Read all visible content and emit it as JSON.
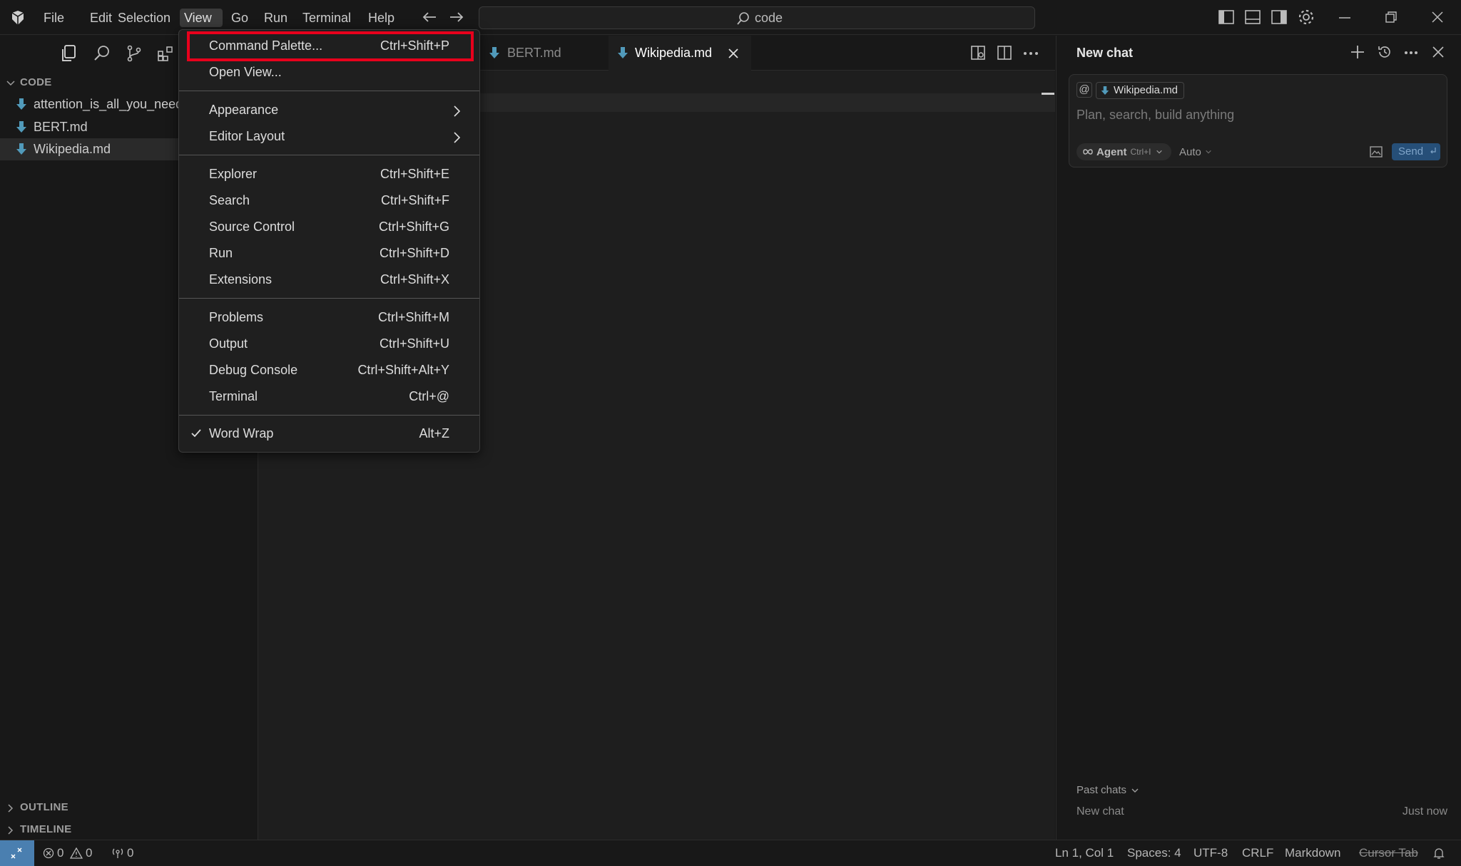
{
  "titlebar": {
    "menus": [
      "File",
      "Edit",
      "Selection",
      "View",
      "Go",
      "Run",
      "Terminal",
      "Help"
    ],
    "active_menu": "View",
    "command_center": "code"
  },
  "sidebar": {
    "section_title": "CODE",
    "files": [
      "attention_is_all_you_need.md",
      "BERT.md",
      "Wikipedia.md"
    ],
    "selected_file": "Wikipedia.md",
    "outline_label": "OUTLINE",
    "timeline_label": "TIMELINE"
  },
  "tabs": [
    {
      "label": "BERT.md",
      "active": false
    },
    {
      "label": "Wikipedia.md",
      "active": true
    }
  ],
  "view_menu": {
    "groups": [
      [
        {
          "label": "Command Palette...",
          "shortcut": "Ctrl+Shift+P",
          "highlighted": true
        },
        {
          "label": "Open View...",
          "shortcut": ""
        }
      ],
      [
        {
          "label": "Appearance",
          "submenu": true
        },
        {
          "label": "Editor Layout",
          "submenu": true
        }
      ],
      [
        {
          "label": "Explorer",
          "shortcut": "Ctrl+Shift+E"
        },
        {
          "label": "Search",
          "shortcut": "Ctrl+Shift+F"
        },
        {
          "label": "Source Control",
          "shortcut": "Ctrl+Shift+G"
        },
        {
          "label": "Run",
          "shortcut": "Ctrl+Shift+D"
        },
        {
          "label": "Extensions",
          "shortcut": "Ctrl+Shift+X"
        }
      ],
      [
        {
          "label": "Problems",
          "shortcut": "Ctrl+Shift+M"
        },
        {
          "label": "Output",
          "shortcut": "Ctrl+Shift+U"
        },
        {
          "label": "Debug Console",
          "shortcut": "Ctrl+Shift+Alt+Y"
        },
        {
          "label": "Terminal",
          "shortcut": "Ctrl+@"
        }
      ],
      [
        {
          "label": "Word Wrap",
          "shortcut": "Alt+Z",
          "checked": true
        }
      ]
    ]
  },
  "chat": {
    "title": "New chat",
    "context_chip": "Wikipedia.md",
    "context_symbol": "@",
    "placeholder": "Plan, search, build anything",
    "agent_label": "Agent",
    "agent_shortcut": "Ctrl+I",
    "model_label": "Auto",
    "send_label": "Send",
    "past_chats_label": "Past chats",
    "past_chats": [
      {
        "title": "New chat",
        "time": "Just now"
      }
    ]
  },
  "statusbar": {
    "errors": "0",
    "warnings": "0",
    "ports": "0",
    "position": "Ln 1, Col 1",
    "spaces": "Spaces: 4",
    "encoding": "UTF-8",
    "eol": "CRLF",
    "language": "Markdown",
    "cursor_tab": "Cursor Tab"
  },
  "colors": {
    "highlight_box": "#e8001c",
    "markdown_icon": "#519aba",
    "send_button": "#264f78"
  }
}
